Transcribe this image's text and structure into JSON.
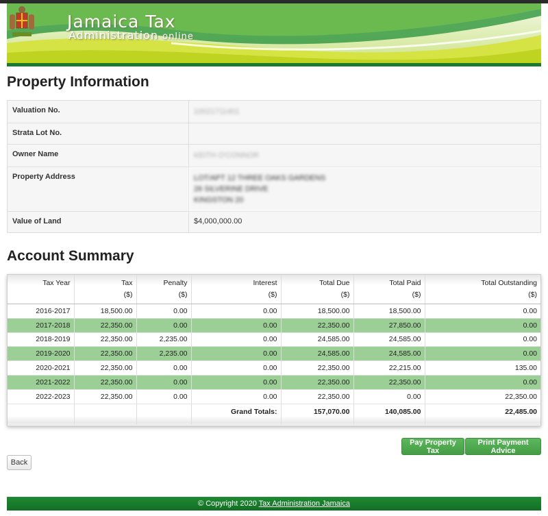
{
  "header": {
    "title": "Jamaica Tax",
    "subtitle": "Administration",
    "subtitle_suffix": "online",
    "crest_icon": "jamaica-coat-of-arms-icon"
  },
  "property": {
    "heading": "Property Information",
    "rows": [
      {
        "label": "Valuation No.",
        "value": "10021711401"
      },
      {
        "label": "Strata Lot No.",
        "value": ""
      },
      {
        "label": "Owner Name",
        "value": "KEITH O'CONNOR"
      },
      {
        "label": "Property Address",
        "lines": [
          "LOT/APT 12 THREE OAKS GARDENS",
          "26 SILVERINE DRIVE",
          "KINGSTON 20"
        ]
      },
      {
        "label": "Value of Land",
        "value": "$4,000,000.00"
      }
    ]
  },
  "account": {
    "heading": "Account Summary",
    "columns": [
      {
        "name": "Tax Year",
        "unit": ""
      },
      {
        "name": "Tax",
        "unit": "($)"
      },
      {
        "name": "Penalty",
        "unit": "($)"
      },
      {
        "name": "Interest",
        "unit": "($)"
      },
      {
        "name": "Total Due",
        "unit": "($)"
      },
      {
        "name": "Total Paid",
        "unit": "($)"
      },
      {
        "name": "Total Outstanding",
        "unit": "($)"
      }
    ],
    "rows": [
      [
        "2016-2017",
        "18,500.00",
        "0.00",
        "0.00",
        "18,500.00",
        "18,500.00",
        "0.00"
      ],
      [
        "2017-2018",
        "22,350.00",
        "0.00",
        "0.00",
        "22,350.00",
        "27,850.00",
        "0.00"
      ],
      [
        "2018-2019",
        "22,350.00",
        "2,235.00",
        "0.00",
        "24,585.00",
        "24,585.00",
        "0.00"
      ],
      [
        "2019-2020",
        "22,350.00",
        "2,235.00",
        "0.00",
        "24,585.00",
        "24,585.00",
        "0.00"
      ],
      [
        "2020-2021",
        "22,350.00",
        "0.00",
        "0.00",
        "22,350.00",
        "22,215.00",
        "135.00"
      ],
      [
        "2021-2022",
        "22,350.00",
        "0.00",
        "0.00",
        "22,350.00",
        "22,350.00",
        "0.00"
      ],
      [
        "2022-2023",
        "22,350.00",
        "0.00",
        "0.00",
        "22,350.00",
        "0.00",
        "22,350.00"
      ]
    ],
    "totals": {
      "label": "Grand Totals:",
      "total_due": "157,070.00",
      "total_paid": "140,085.00",
      "total_outstanding": "22,485.00"
    }
  },
  "buttons": {
    "pay": "Pay Property Tax",
    "print": "Print Payment Advice",
    "back": "Back"
  },
  "footer": {
    "copyright": "© Copyright 2020",
    "link": "Tax Administration Jamaica"
  },
  "colors": {
    "brand_green": "#1b7a2e",
    "row_highlight": "#9ccf96",
    "button_green": "#5cb85c"
  }
}
